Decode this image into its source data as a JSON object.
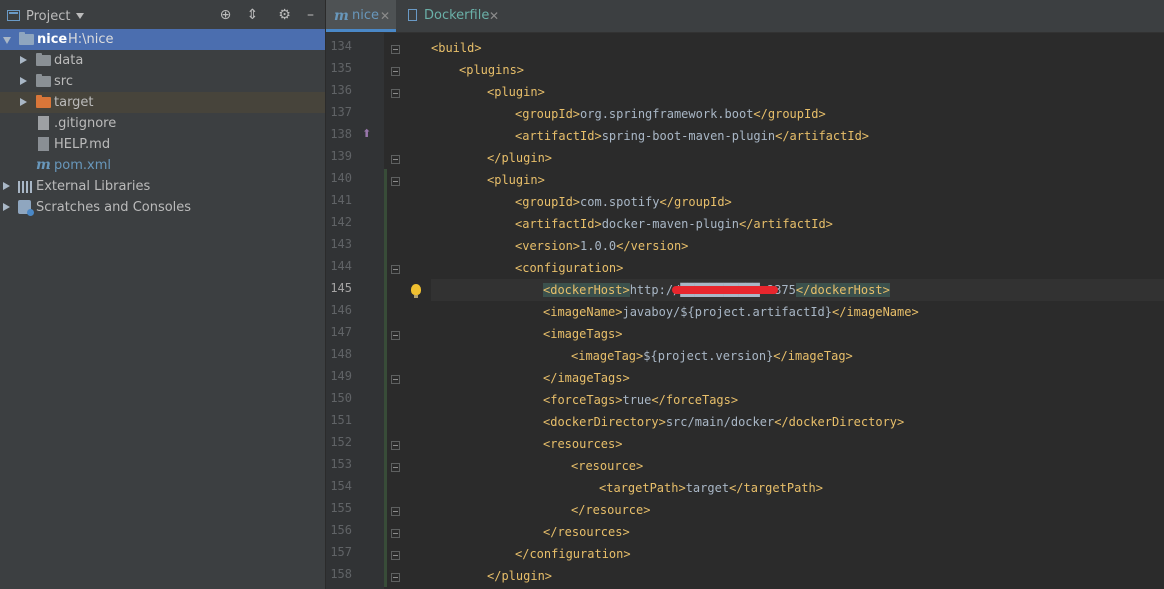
{
  "project_panel": {
    "title": "Project",
    "root": {
      "name": "nice",
      "path": "H:\\nice"
    },
    "items": [
      {
        "label": "data"
      },
      {
        "label": "src"
      },
      {
        "label": "target"
      },
      {
        "label": ".gitignore"
      },
      {
        "label": "HELP.md"
      },
      {
        "label": "pom.xml"
      },
      {
        "label": "External Libraries"
      },
      {
        "label": "Scratches and Consoles"
      }
    ]
  },
  "tabs": [
    {
      "label": "nice",
      "active": true
    },
    {
      "label": "Dockerfile",
      "active": false
    }
  ],
  "editor": {
    "current_line": 145,
    "lines": [
      {
        "n": "134",
        "parts": [
          [
            "t",
            "<build>"
          ]
        ]
      },
      {
        "n": "135",
        "parts": [
          [
            "t",
            "<plugins>"
          ]
        ]
      },
      {
        "n": "136",
        "parts": [
          [
            "t",
            "<plugin>"
          ]
        ]
      },
      {
        "n": "137",
        "parts": [
          [
            "t",
            "<groupId>"
          ],
          [
            "x",
            "org.springframework.boot"
          ],
          [
            "t",
            "</groupId>"
          ]
        ]
      },
      {
        "n": "138",
        "parts": [
          [
            "t",
            "<artifactId>"
          ],
          [
            "x",
            "spring-boot-maven-plugin"
          ],
          [
            "t",
            "</artifactId>"
          ]
        ]
      },
      {
        "n": "139",
        "parts": [
          [
            "t",
            "</plugin>"
          ]
        ]
      },
      {
        "n": "140",
        "parts": [
          [
            "t",
            "<plugin>"
          ]
        ]
      },
      {
        "n": "141",
        "parts": [
          [
            "t",
            "<groupId>"
          ],
          [
            "x",
            "com.spotify"
          ],
          [
            "t",
            "</groupId>"
          ]
        ]
      },
      {
        "n": "142",
        "parts": [
          [
            "t",
            "<artifactId>"
          ],
          [
            "x",
            "docker-maven-plugin"
          ],
          [
            "t",
            "</artifactId>"
          ]
        ]
      },
      {
        "n": "143",
        "parts": [
          [
            "t",
            "<version>"
          ],
          [
            "x",
            "1.0.0"
          ],
          [
            "t",
            "</version>"
          ]
        ]
      },
      {
        "n": "144",
        "parts": [
          [
            "t",
            "<configuration>"
          ]
        ]
      },
      {
        "n": "145",
        "parts": [
          [
            "h",
            "<dockerHost>"
          ],
          [
            "x",
            "http://███████████:2375"
          ],
          [
            "h",
            "</dockerHost>"
          ]
        ]
      },
      {
        "n": "146",
        "parts": [
          [
            "t",
            "<imageName>"
          ],
          [
            "x",
            "javaboy/${project.artifactId}"
          ],
          [
            "t",
            "</imageName>"
          ]
        ]
      },
      {
        "n": "147",
        "parts": [
          [
            "t",
            "<imageTags>"
          ]
        ]
      },
      {
        "n": "148",
        "parts": [
          [
            "t",
            "<imageTag>"
          ],
          [
            "x",
            "${project.version}"
          ],
          [
            "t",
            "</imageTag>"
          ]
        ]
      },
      {
        "n": "149",
        "parts": [
          [
            "t",
            "</imageTags>"
          ]
        ]
      },
      {
        "n": "150",
        "parts": [
          [
            "t",
            "<forceTags>"
          ],
          [
            "x",
            "true"
          ],
          [
            "t",
            "</forceTags>"
          ]
        ]
      },
      {
        "n": "151",
        "parts": [
          [
            "t",
            "<dockerDirectory>"
          ],
          [
            "x",
            "src/main/docker"
          ],
          [
            "t",
            "</dockerDirectory>"
          ]
        ]
      },
      {
        "n": "152",
        "parts": [
          [
            "t",
            "<resources>"
          ]
        ]
      },
      {
        "n": "153",
        "parts": [
          [
            "t",
            "<resource>"
          ]
        ]
      },
      {
        "n": "154",
        "parts": [
          [
            "t",
            "<targetPath>"
          ],
          [
            "x",
            "target"
          ],
          [
            "t",
            "</targetPath>"
          ]
        ]
      },
      {
        "n": "155",
        "parts": [
          [
            "t",
            "</resource>"
          ]
        ]
      },
      {
        "n": "156",
        "parts": [
          [
            "t",
            "</resources>"
          ]
        ]
      },
      {
        "n": "157",
        "parts": [
          [
            "t",
            "</configuration>"
          ]
        ]
      },
      {
        "n": "158",
        "parts": [
          [
            "t",
            "</plugin>"
          ]
        ]
      }
    ]
  },
  "colors": {
    "tag": "#e8bf6a",
    "text": "#a9b7c6",
    "selection": "#4b6eaf",
    "redaction": "#e8262d"
  }
}
